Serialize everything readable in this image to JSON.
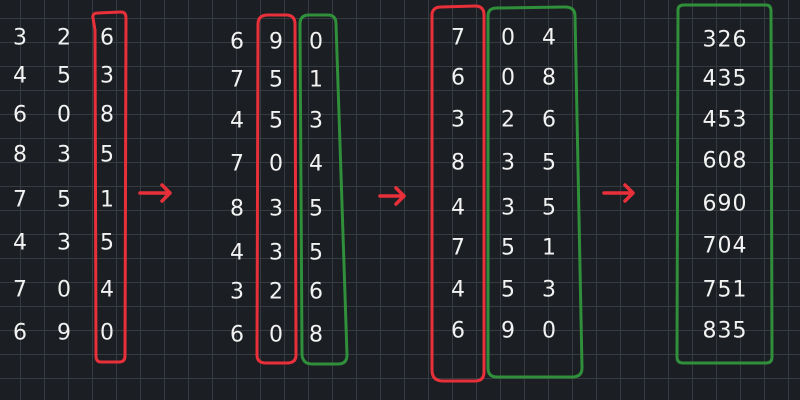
{
  "colors": {
    "background": "#1b1e22",
    "grid": "#363b42",
    "digits": "#f2f2f2",
    "highlight_current_digit": "#e8303a",
    "highlight_sorted_digits": "#2f8f3a",
    "arrow": "#e8303a"
  },
  "passes": [
    {
      "rows": [
        [
          "3",
          "2",
          "6"
        ],
        [
          "4",
          "5",
          "3"
        ],
        [
          "6",
          "0",
          "8"
        ],
        [
          "8",
          "3",
          "5"
        ],
        [
          "7",
          "5",
          "1"
        ],
        [
          "4",
          "3",
          "5"
        ],
        [
          "7",
          "0",
          "4"
        ],
        [
          "6",
          "9",
          "0"
        ]
      ]
    },
    {
      "rows": [
        [
          "6",
          "9",
          "0"
        ],
        [
          "7",
          "5",
          "1"
        ],
        [
          "4",
          "5",
          "3"
        ],
        [
          "7",
          "0",
          "4"
        ],
        [
          "8",
          "3",
          "5"
        ],
        [
          "4",
          "3",
          "5"
        ],
        [
          "3",
          "2",
          "6"
        ],
        [
          "6",
          "0",
          "8"
        ]
      ]
    },
    {
      "rows": [
        [
          "7",
          "0",
          "4"
        ],
        [
          "6",
          "0",
          "8"
        ],
        [
          "3",
          "2",
          "6"
        ],
        [
          "8",
          "3",
          "5"
        ],
        [
          "4",
          "3",
          "5"
        ],
        [
          "7",
          "5",
          "1"
        ],
        [
          "4",
          "5",
          "3"
        ],
        [
          "6",
          "9",
          "0"
        ]
      ]
    }
  ],
  "result": [
    "326",
    "435",
    "453",
    "608",
    "690",
    "704",
    "751",
    "835"
  ],
  "arrows": [
    {
      "icon": "right-arrow-icon"
    },
    {
      "icon": "right-arrow-icon"
    },
    {
      "icon": "right-arrow-icon"
    }
  ]
}
